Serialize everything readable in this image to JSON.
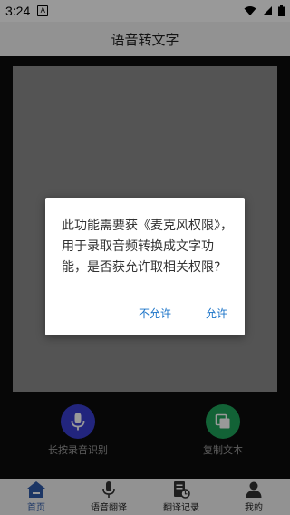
{
  "status_bar": {
    "time": "3:24",
    "notification_label": "A"
  },
  "app_bar": {
    "title": "语音转文字"
  },
  "actions": {
    "record": {
      "label": "长按录音识别",
      "color": "#3a3fd0"
    },
    "copy": {
      "label": "复制文本",
      "color": "#1fa35a"
    }
  },
  "tabs": [
    {
      "label": "首页",
      "icon": "home-icon",
      "active": true
    },
    {
      "label": "语音翻译",
      "icon": "mic-icon",
      "active": false
    },
    {
      "label": "翻译记录",
      "icon": "document-clock-icon",
      "active": false
    },
    {
      "label": "我的",
      "icon": "person-icon",
      "active": false
    }
  ],
  "dialog": {
    "message": "此功能需要获《麦克风权限》，用于录取音频转换成文字功能，是否获允许取相关权限?",
    "deny_label": "不允许",
    "allow_label": "允许",
    "button_color": "#1a73c8"
  }
}
